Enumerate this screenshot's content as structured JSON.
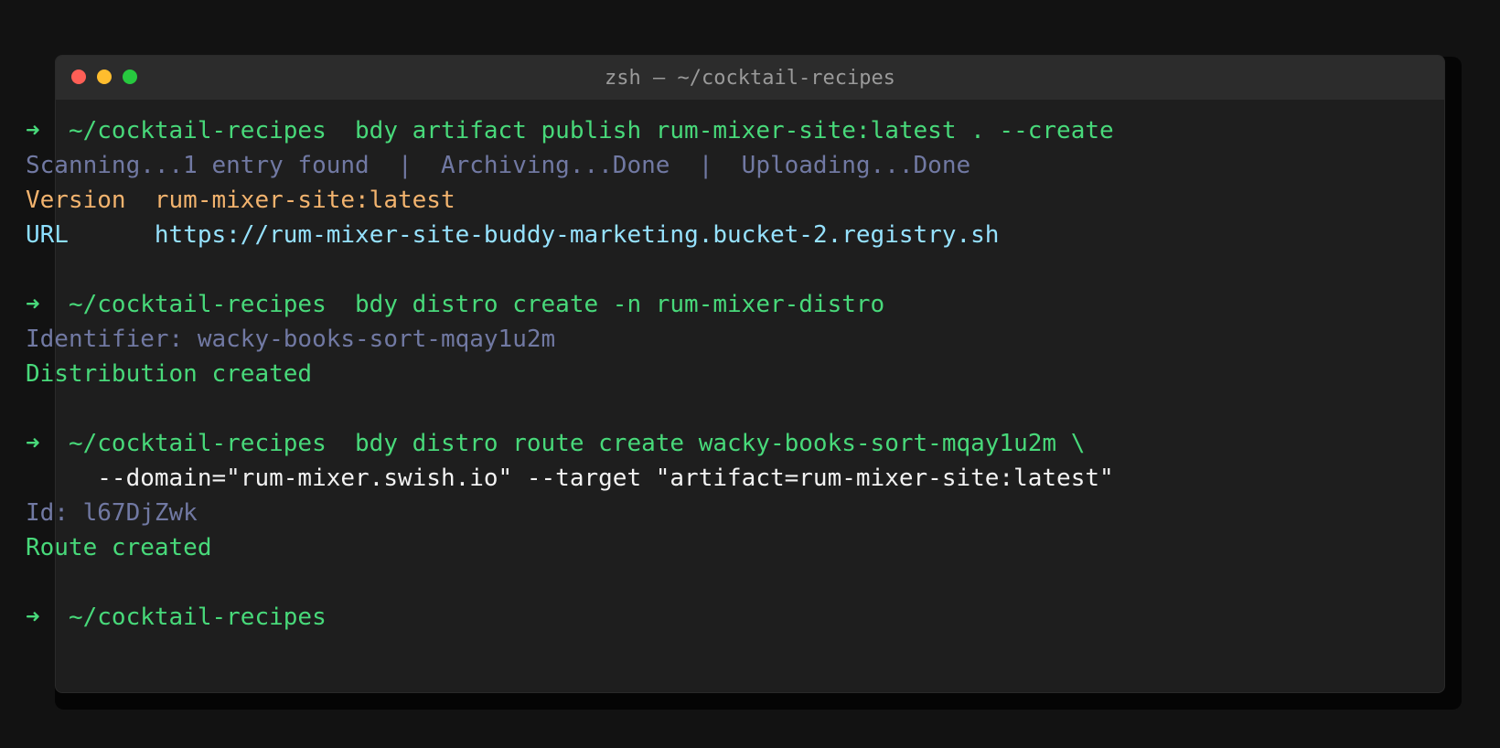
{
  "window": {
    "title": "zsh — ~/cocktail-recipes",
    "controls": [
      {
        "name": "close",
        "color": "#ff5f56"
      },
      {
        "name": "minimize",
        "color": "#ffbd2e"
      },
      {
        "name": "maximize",
        "color": "#27c93f"
      }
    ]
  },
  "terminal": {
    "lines": [
      {
        "segments": [
          {
            "text": "➜  ~/cocktail-recipes  bdy artifact publish rum-mixer-site:latest . --create",
            "color": "green"
          }
        ]
      },
      {
        "segments": [
          {
            "text": "Scanning...1 entry found  |  Archiving...Done  |  Uploading...Done",
            "color": "muted"
          }
        ]
      },
      {
        "segments": [
          {
            "text": "Version  rum-mixer-site:latest",
            "color": "orange"
          }
        ]
      },
      {
        "segments": [
          {
            "text": "URL      ",
            "color": "cyan"
          },
          {
            "text": "https://rum-mixer-site-buddy-marketing.bucket-2.registry.sh",
            "color": "url"
          }
        ]
      },
      {
        "segments": []
      },
      {
        "segments": [
          {
            "text": "➜  ~/cocktail-recipes  bdy distro create -n rum-mixer-distro",
            "color": "green"
          }
        ]
      },
      {
        "segments": [
          {
            "text": "Identifier: wacky-books-sort-mqay1u2m",
            "color": "muted"
          }
        ]
      },
      {
        "segments": [
          {
            "text": "Distribution created",
            "color": "green"
          }
        ]
      },
      {
        "segments": []
      },
      {
        "segments": [
          {
            "text": "➜  ~/cocktail-recipes  bdy distro route create wacky-books-sort-mqay1u2m \\",
            "color": "green"
          }
        ]
      },
      {
        "segments": [
          {
            "text": "     --domain=\"rum-mixer.swish.io\" --target \"artifact=rum-mixer-site:latest\"",
            "color": "white"
          }
        ]
      },
      {
        "segments": [
          {
            "text": "Id: l67DjZwk",
            "color": "muted"
          }
        ]
      },
      {
        "segments": [
          {
            "text": "Route created",
            "color": "green"
          }
        ]
      },
      {
        "segments": []
      },
      {
        "segments": [
          {
            "text": "➜  ~/cocktail-recipes",
            "color": "green"
          }
        ]
      }
    ]
  }
}
